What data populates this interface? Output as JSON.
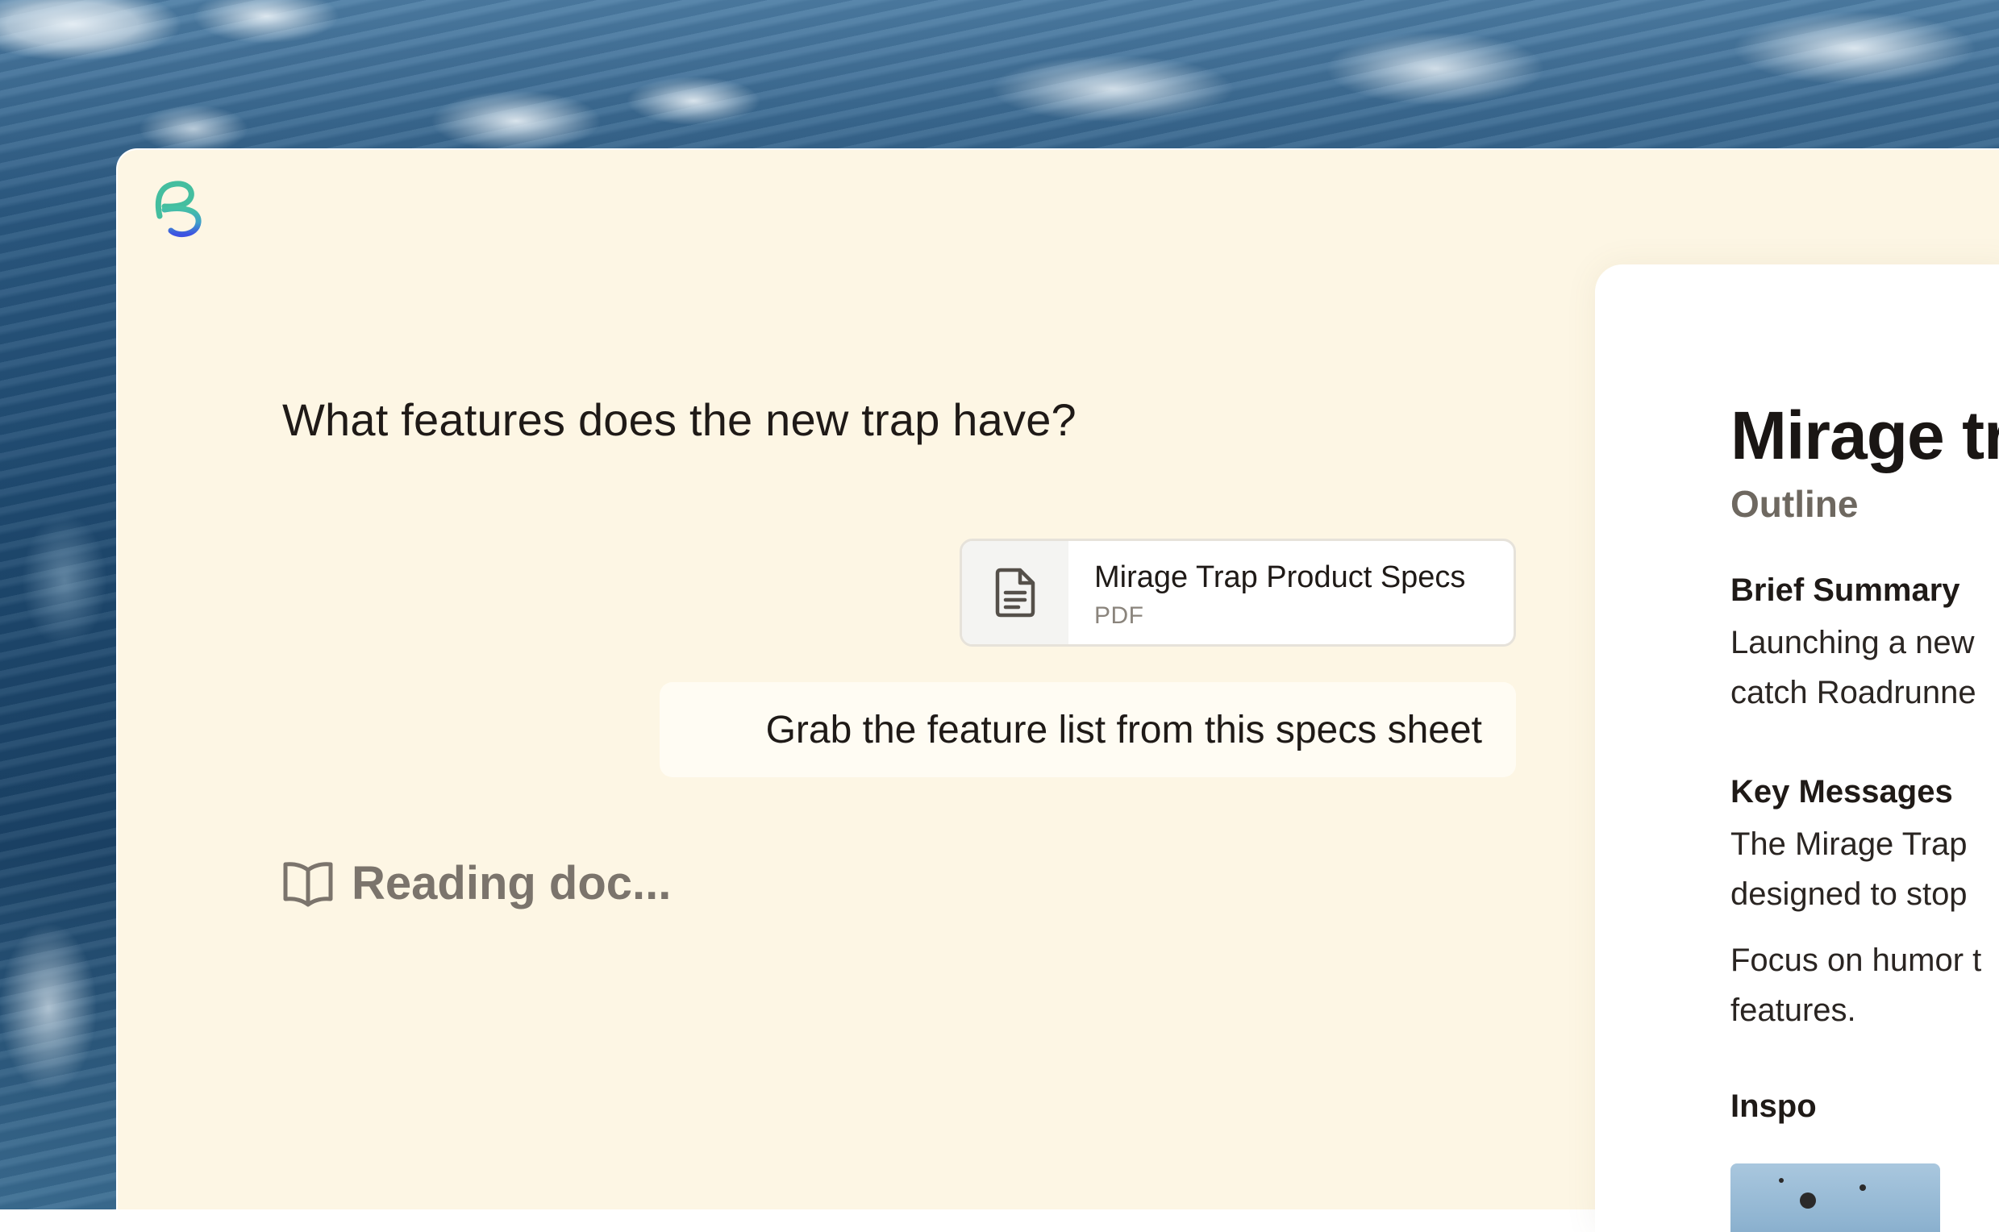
{
  "conversation": {
    "question": "What features does the new trap have?",
    "attachment": {
      "name": "Mirage Trap Product Specs",
      "type": "PDF",
      "icon": "document-icon"
    },
    "user_message": "Grab the feature list from this specs sheet",
    "status": {
      "icon": "open-book-icon",
      "label": "Reading doc..."
    }
  },
  "document": {
    "title": "Mirage tr",
    "subtitle": "Outline",
    "sections": [
      {
        "heading": "Brief Summary",
        "lines": [
          "Launching a new",
          "catch Roadrunne"
        ]
      },
      {
        "heading": "Key Messages",
        "lines": [
          "The Mirage Trap",
          "designed to stop",
          "Focus on humor t",
          "features."
        ]
      },
      {
        "heading": "Inspo",
        "lines": []
      }
    ]
  },
  "colors": {
    "app_background": "#fdf6e4",
    "panel_background": "#ffffff",
    "logo_teal": "#3fb9a0",
    "logo_blue": "#3f5be0"
  }
}
